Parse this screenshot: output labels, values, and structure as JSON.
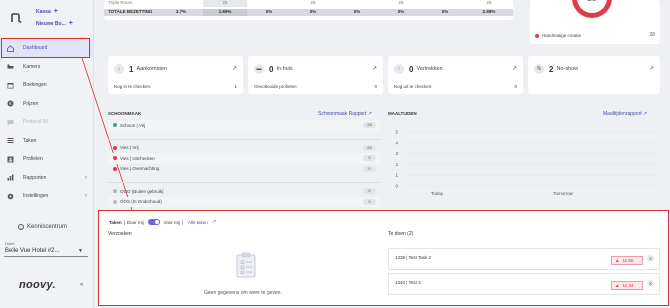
{
  "brand": {
    "line1": "Kassa",
    "line2": "Nieuwe Bo...",
    "plus": "+"
  },
  "sidebar": {
    "items": [
      {
        "label": "Dashboard",
        "icon": "home-icon"
      },
      {
        "label": "Kamers",
        "icon": "bed-icon"
      },
      {
        "label": "Boekingen",
        "icon": "calendar-icon"
      },
      {
        "label": "Prijzen",
        "icon": "euro-icon"
      },
      {
        "label": "Protocol IN",
        "icon": "chat-icon"
      },
      {
        "label": "Taken",
        "icon": "tasks-icon"
      },
      {
        "label": "Profielen",
        "icon": "id-card-icon"
      },
      {
        "label": "Rapporten",
        "icon": "chart-icon"
      },
      {
        "label": "Instellingen",
        "icon": "gear-icon"
      }
    ],
    "kenniscentrum": "Kenniscentrum",
    "hotel_label": "Hotel",
    "hotel_value": "Belle Vue Hotel #2...",
    "logo": "noovy."
  },
  "top_table": {
    "row1": [
      "Triple Room",
      "",
      "25",
      "",
      "25",
      "",
      "25",
      "",
      "25",
      "2"
    ],
    "row2": [
      "TOTALE BEZETTING",
      "3.7%",
      "1.65%",
      "0%",
      "0%",
      "0%",
      "0%",
      "0%",
      "2.98%"
    ]
  },
  "donut": {
    "value": "28",
    "legend": "Handmatige creatie",
    "legend_value": "28"
  },
  "stats": [
    {
      "icon": "arrival-icon",
      "num": "1",
      "title": "Aankomsten",
      "sub_label": "Nog in te checken:",
      "sub_value": "1"
    },
    {
      "icon": "bed-icon",
      "num": "0",
      "title": "In huis",
      "sub_label": "Onvoltooide profielen:",
      "sub_value": "0"
    },
    {
      "icon": "departure-icon",
      "num": "0",
      "title": "Vertrekken",
      "sub_label": "Nog uit te checken:",
      "sub_value": "0"
    },
    {
      "icon": "no-show-icon",
      "num": "2",
      "title": "No-show",
      "sub_label": "",
      "sub_value": ""
    }
  ],
  "schoonmaak": {
    "title": "SCHOONMAAK",
    "link": "Schoonmaak Rapport",
    "rows": [
      {
        "label": "Schoon | Vrij",
        "value": "26",
        "color": "#3aa876"
      },
      {
        "label": "Vies | Vrij",
        "value": "26",
        "color": "#e03a4e"
      },
      {
        "label": "Vies | Uitchecken",
        "value": "2",
        "color": "#e03a4e"
      },
      {
        "label": "Vies | Overnachting",
        "value": "0",
        "color": "#e03a4e"
      },
      {
        "label": "OOO (Buiten gebruik)",
        "value": "0",
        "color": "#b5b8be"
      },
      {
        "label": "OOS (In Onderhoud)",
        "value": "0",
        "color": "#b5b8be"
      }
    ]
  },
  "maaltijden": {
    "title": "MAALTIJDEN",
    "link": "Maaltijdenrapport"
  },
  "chart_data": {
    "type": "bar",
    "categories": [
      "Today",
      "Tomorrow"
    ],
    "values": [
      0,
      0
    ],
    "ylim": [
      0,
      5
    ],
    "yticks": [
      "0",
      "1",
      "2",
      "3",
      "4",
      "5"
    ],
    "grid": true
  },
  "tasks": {
    "label_taken": "Taken",
    "label_door_mij": "Door mij",
    "label_voor_mij": "Voor mij",
    "link_alle": "Alle taken",
    "verzoeken_title": "Verzoeken",
    "empty_text": "Geen gegevens om weer te geven.",
    "todo_title": "Te doen (2)",
    "items": [
      {
        "text": "1339 | Test Task 2",
        "time": "11:50"
      },
      {
        "text": "1340 | Test 3",
        "time": "11:34"
      }
    ]
  },
  "colors": {
    "accent": "#4a4ab0",
    "danger": "#e03a4e",
    "highlight": "#d9302b"
  }
}
